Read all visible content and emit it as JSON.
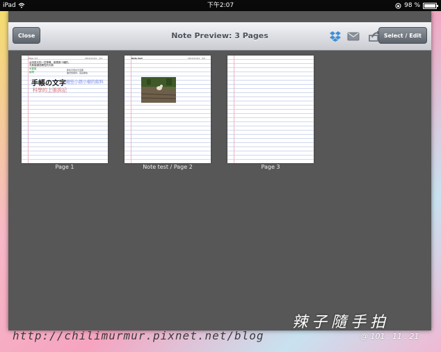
{
  "status_bar": {
    "device": "iPad",
    "time": "下午2:07",
    "battery": "98 %",
    "battery_level": 0.98
  },
  "nav": {
    "close_label": "Close",
    "title": "Note Preview: 3 Pages",
    "select_edit_label": "Select / Edit"
  },
  "icons": {
    "dropbox": "dropbox-icon",
    "mail": "mail-icon",
    "share": "share-icon",
    "wifi": "wifi-icon",
    "rotation_lock": "rotation-lock-icon"
  },
  "pages": [
    {
      "label": "Page 1",
      "header_left": "Page 1/3",
      "header_right": "2012/11/21 · 1/3",
      "lines": [
        "台灣夏天的一些草莓，都是數十種的。",
        "天氣變通週期性的天氣"
      ],
      "bullet1": "可愛區",
      "bullet2": "秘境",
      "side1": "那些天很熱天還要",
      "side2": "雖然很擁擠，還是要拍",
      "big_text": "手帳の文字",
      "blue_text": "繪些小蔬小樹的飲料",
      "red_text": "科學的上張拆記"
    },
    {
      "label": "Note test / Page 2",
      "header_left": "Note test",
      "header_right": "2012/11/21 · 2/3"
    },
    {
      "label": "Page 3"
    }
  ],
  "watermark": {
    "url": "http://chilimurmur.pixnet.net/blog",
    "signature": "辣子隨手拍",
    "date": "@ 101 . 11 . 21"
  },
  "colors": {
    "nav_button": "#6e747c",
    "page_margin": "#efb5c5",
    "page_rule": "#cfd8ee",
    "dropbox_blue": "#3d8fd8"
  }
}
